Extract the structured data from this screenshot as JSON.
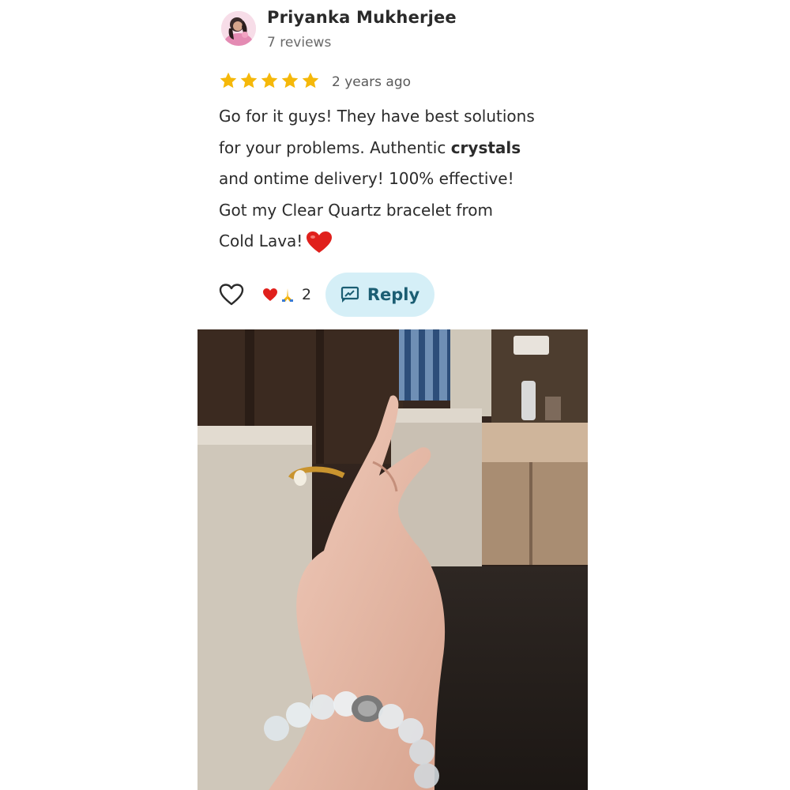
{
  "review": {
    "author_name": "Priyanka Mukherjee",
    "author_meta": "7 reviews",
    "rating": 5,
    "time_ago": "2 years ago",
    "text_line1": "Go for it guys! They have best solutions",
    "text_line2a": "for your problems. Authentic ",
    "text_line2b": "crystals",
    "text_line3": "and ontime delivery! 100% effective!",
    "text_line4": "Got my Clear Quartz bracelet from",
    "text_line5": "Cold Lava!"
  },
  "actions": {
    "reaction_count": "2",
    "reply_label": "Reply"
  },
  "colors": {
    "star": "#f5b80a",
    "reply_bg": "#d5eff7",
    "reply_text": "#1b5e73"
  }
}
